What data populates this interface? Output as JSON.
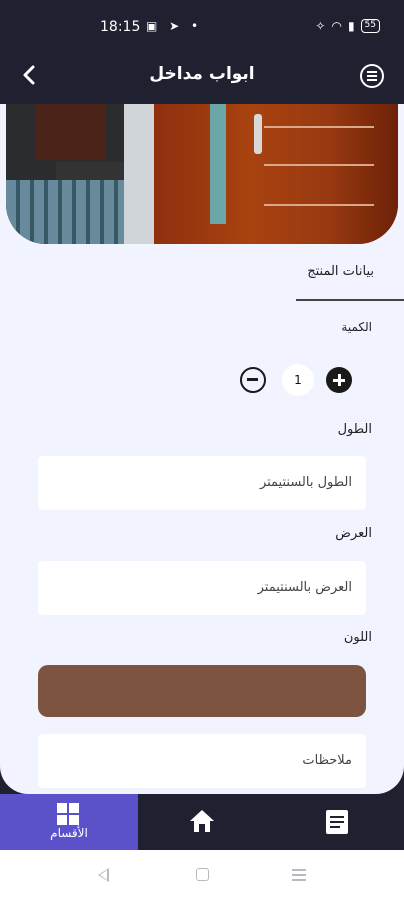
{
  "status": {
    "time": "18:15",
    "battery": "55"
  },
  "header": {
    "title": "ابواب مداخل"
  },
  "product": {
    "section_tab": "بيانات المنتج",
    "quantity_label": "الكمية",
    "quantity_value": "1",
    "length_label": "الطول",
    "length_placeholder": "الطول بالسنتيمتر",
    "width_label": "العرض",
    "width_placeholder": "العرض بالسنتيمتر",
    "color_label": "اللون",
    "color_value": "#7d5341",
    "notes_placeholder": "ملاحظات"
  },
  "bottom_nav": {
    "items": [
      {
        "label": "الأقسام",
        "icon": "grid-icon",
        "active": true
      },
      {
        "label": "",
        "icon": "home-icon",
        "active": false
      },
      {
        "label": "",
        "icon": "orders-icon",
        "active": false
      }
    ]
  },
  "colors": {
    "dark": "#1f2130",
    "accent": "#5b52c9",
    "background": "#f1f3ff"
  }
}
